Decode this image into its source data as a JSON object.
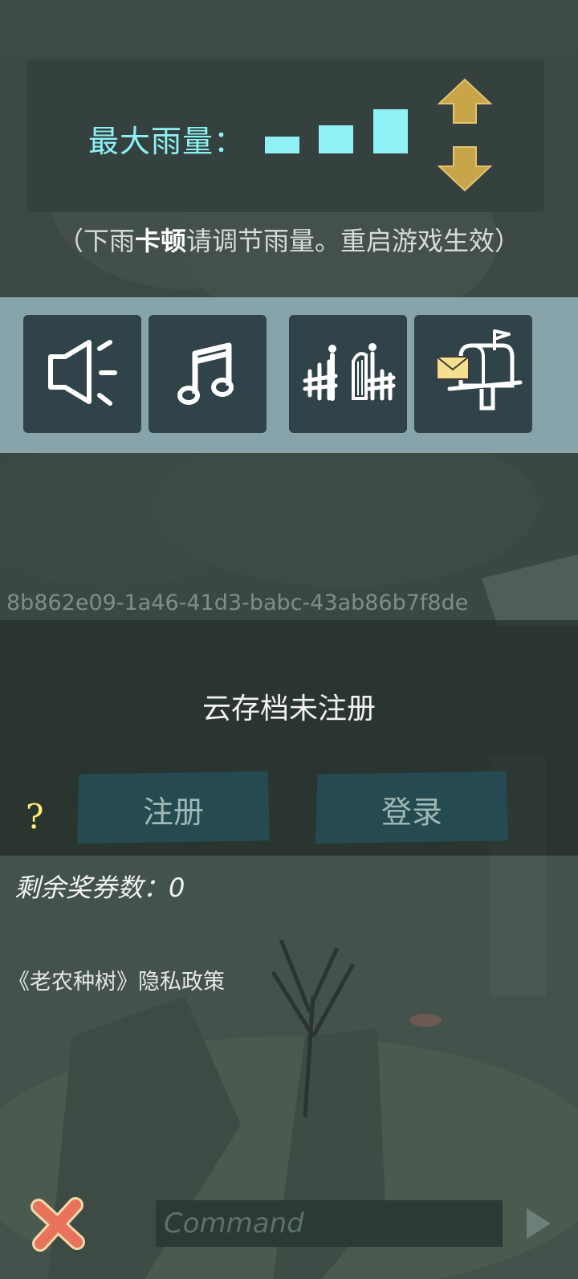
{
  "rain_settings": {
    "label": "最大雨量：",
    "level": 3,
    "level_max": 3,
    "bar_color": "#8ff0f5",
    "up_icon": "arrow-up-icon",
    "down_icon": "arrow-down-icon",
    "hint_prefix": "（下雨",
    "hint_bold": "卡顿",
    "hint_suffix": "请调节雨量。重启游戏生效）"
  },
  "toolbar": {
    "items": [
      {
        "icon": "speaker-icon"
      },
      {
        "icon": "music-note-icon"
      },
      {
        "icon": "fence-gate-icon"
      },
      {
        "icon": "mailbox-icon"
      }
    ]
  },
  "device_id": "8b862e09-1a46-41d3-babc-43ab86b7f8de",
  "cloud_save": {
    "status": "云存档未注册",
    "register_label": "注册",
    "login_label": "登录",
    "help_label": "?"
  },
  "tickets_text": "剩余奖券数：0",
  "privacy_link": "《老农种树》隐私政策",
  "command": {
    "placeholder": "Command",
    "value": ""
  },
  "colors": {
    "accent": "#8ff0f5",
    "arrow_gold": "#c9a54a",
    "close_red": "#e9725d",
    "help_yellow": "#ffef74"
  }
}
